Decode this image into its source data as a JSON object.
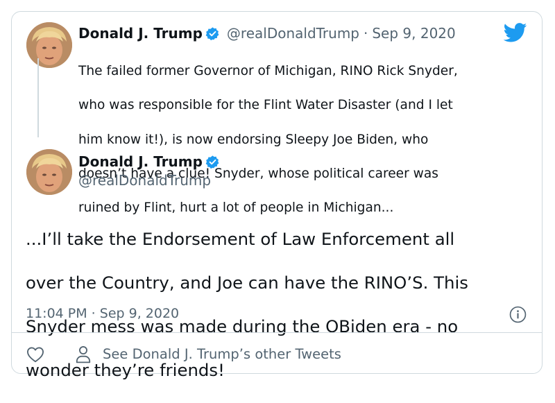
{
  "parent_tweet": {
    "display_name": "Donald J. Trump",
    "handle": "@realDonaldTrump",
    "separator": "·",
    "date": "Sep 9, 2020",
    "lines": [
      "The failed former Governor of Michigan, RINO Rick Snyder,",
      "who was responsible for the Flint Water Disaster (and I let",
      "him know it!), is now endorsing Sleepy Joe Biden, who",
      "doesn’t have a clue! Snyder, whose political career was",
      "ruined by Flint, hurt a lot of people in Michigan..."
    ]
  },
  "main_tweet": {
    "display_name": "Donald J. Trump",
    "handle": "@realDonaldTrump",
    "lines": [
      "...I’ll take the Endorsement of Law Enforcement all",
      "over the Country, and Joe can have the RINO’S. This",
      "Snyder mess was made during the OBiden era - no",
      "wonder they’re friends!"
    ],
    "timestamp": "11:04 PM · Sep 9, 2020"
  },
  "footer": {
    "other_tweets_label": "See Donald J. Trump’s other Tweets"
  },
  "icons": {
    "brand": "twitter-bird-icon",
    "verified": "verified-badge-icon",
    "info": "info-icon",
    "like": "heart-icon",
    "profile": "person-icon"
  },
  "colors": {
    "twitter_blue": "#1d9bf0",
    "text_primary": "#0f1419",
    "text_secondary": "#536471",
    "border": "#cfd9de"
  }
}
